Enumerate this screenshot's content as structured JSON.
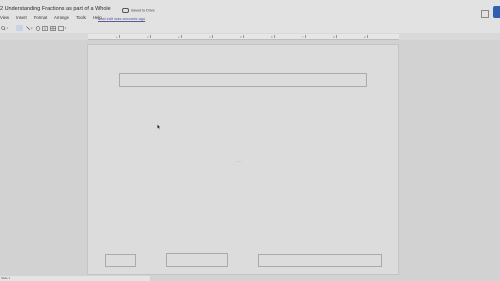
{
  "app": {
    "doc_title": "2 Understanding Fractions as part of a Whole",
    "save_status": "Saved to Drive",
    "last_edit": "Last edit was seconds ago"
  },
  "menu": [
    "View",
    "Insert",
    "Format",
    "Arrange",
    "Tools",
    "Help"
  ],
  "toolbar": {
    "zoom_icon": "zoom-icon",
    "select_icon": "cursor-icon",
    "line_icon": "line-icon",
    "shape_icon": "shape-icon",
    "table_icon": "table-icon",
    "image_icon": "image-icon"
  },
  "ruler": {
    "numbers": [
      "1",
      "2",
      "3",
      "4",
      "5",
      "6",
      "7",
      "8",
      "9"
    ]
  },
  "slide": {
    "page_indicator": "- - -"
  },
  "statusbar": {
    "text": "Slide 1"
  },
  "colors": {
    "accent": "#2f5fb3",
    "link": "#5a5a9a"
  }
}
